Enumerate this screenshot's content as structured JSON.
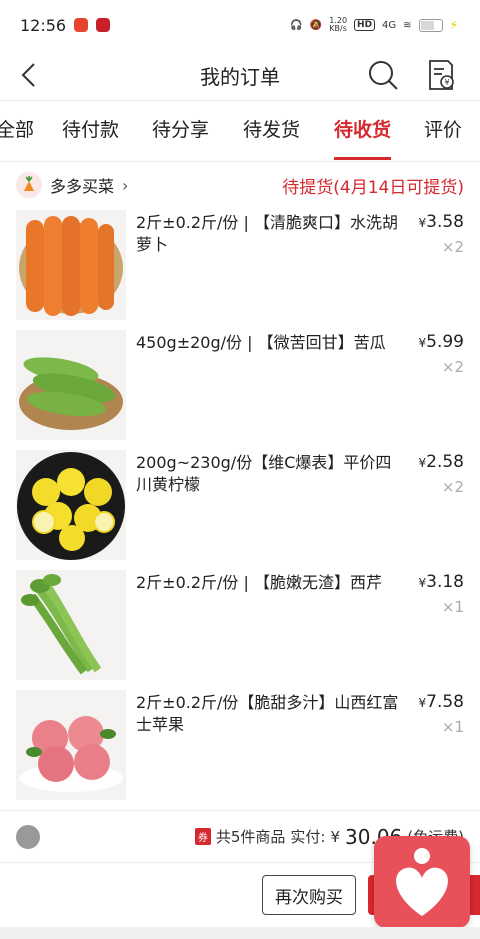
{
  "status_bar": {
    "time": "12:56",
    "network_speed": "1.20\nKB/s",
    "hd": "HD",
    "signal": "4G"
  },
  "header": {
    "title": "我的订单"
  },
  "tabs": [
    "全部",
    "待付款",
    "待分享",
    "待发货",
    "待收货",
    "评价"
  ],
  "active_tab": "待收货",
  "order": {
    "shop_name": "多多买菜",
    "status": "待提货(4月14日可提货)",
    "items": [
      {
        "title": "2斤±0.2斤/份 | 【清脆爽口】水洗胡萝卜",
        "price_symbol": "¥",
        "price": "3.58",
        "qty": "×2"
      },
      {
        "title": "450g±20g/份 | 【微苦回甘】苦瓜",
        "price_symbol": "¥",
        "price": "5.99",
        "qty": "×2"
      },
      {
        "title": "200g~230g/份【维C爆表】平价四川黄柠檬",
        "price_symbol": "¥",
        "price": "2.58",
        "qty": "×2"
      },
      {
        "title": "2斤±0.2斤/份 | 【脆嫩无渣】西芹",
        "price_symbol": "¥",
        "price": "3.18",
        "qty": "×1"
      },
      {
        "title": "2斤±0.2斤/份【脆甜多汁】山西红富士苹果",
        "price_symbol": "¥",
        "price": "7.58",
        "qty": "×1"
      }
    ],
    "summary": {
      "coupon": "券",
      "count_text": "共5件商品",
      "paid_label": "实付:",
      "price_symbol": "¥",
      "total": "30.06",
      "freight": "(免运费)"
    },
    "actions": {
      "rebuy": "再次购买"
    }
  },
  "colors": {
    "accent": "#d6282f",
    "badge": "#e8515a"
  }
}
